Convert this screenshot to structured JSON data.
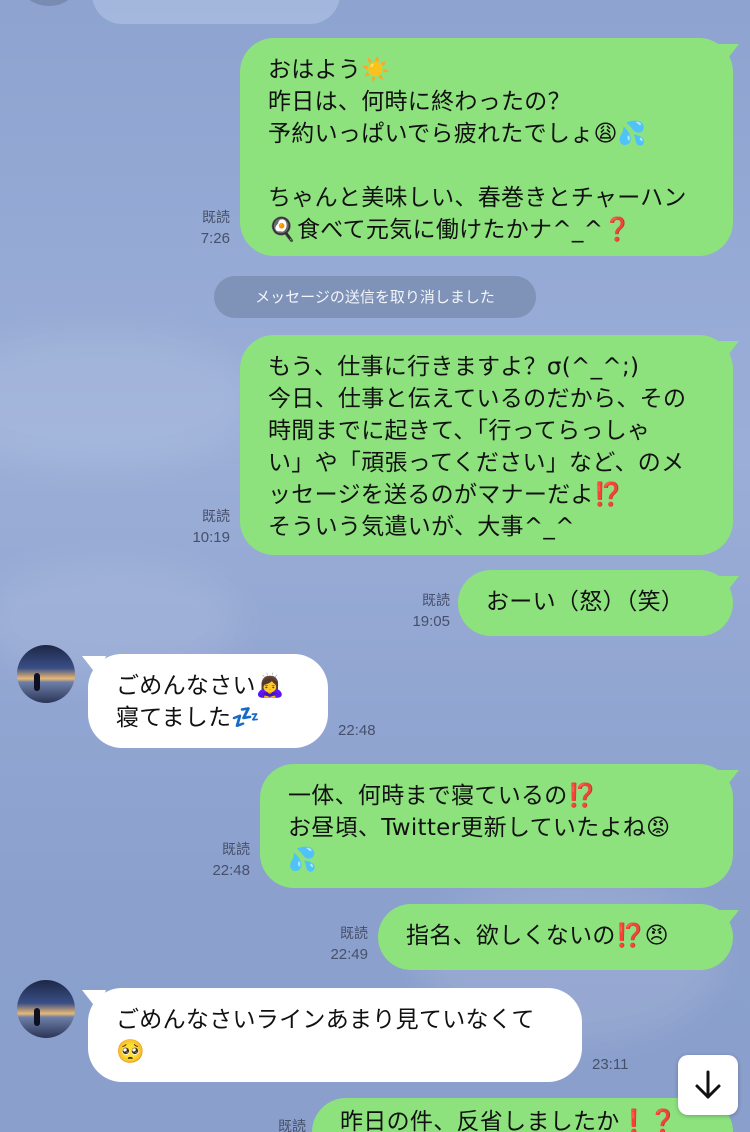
{
  "top_partial_label": "",
  "system_notice": "メッセージの送信を取り消しました",
  "messages": [
    {
      "text": "おはよう☀️\n昨日は、何時に終わったの？\n予約いっぱいでら疲れたでしょ😩💦\n\nちゃんと美味しい、春巻きとチャーハン\n🍳食べて元気に働けたかナ^_^❓",
      "read": "既読",
      "time": "7:26"
    },
    {
      "text": "もう、仕事に行きますよ？σ(^_^;)\n今日、仕事と伝えているのだから、その\n時間までに起きて、「行ってらっしゃ\nい」や「頑張ってください」など、のメ\nッセージを送るのがマナーだよ⁉️\nそういう気遣いが、大事^_^",
      "read": "既読",
      "time": "10:19"
    },
    {
      "text": "おーい（怒）（笑）",
      "read": "既読",
      "time": "19:05"
    },
    {
      "text": "ごめんなさい🙇‍♀️\n寝てました💤",
      "time": "22:48"
    },
    {
      "text": "一体、何時まで寝ているの⁉️\nお昼頃、Twitter更新していたよね😡\n💦",
      "read": "既読",
      "time": "22:48"
    },
    {
      "text": "指名、欲しくないの⁉️😠",
      "read": "既読",
      "time": "22:49"
    },
    {
      "text": "ごめんなさいラインあまり見ていなくて\n🥺",
      "time": "23:11"
    },
    {
      "text": "昨日の件、反省しましたか❗️❓",
      "read": "既読"
    }
  ],
  "scroll_icon": "arrow-down-icon",
  "colors": {
    "background": "#92a6d2",
    "outgoing_bubble": "#8de27d",
    "incoming_bubble": "#ffffff",
    "meta_text": "#46506a"
  }
}
